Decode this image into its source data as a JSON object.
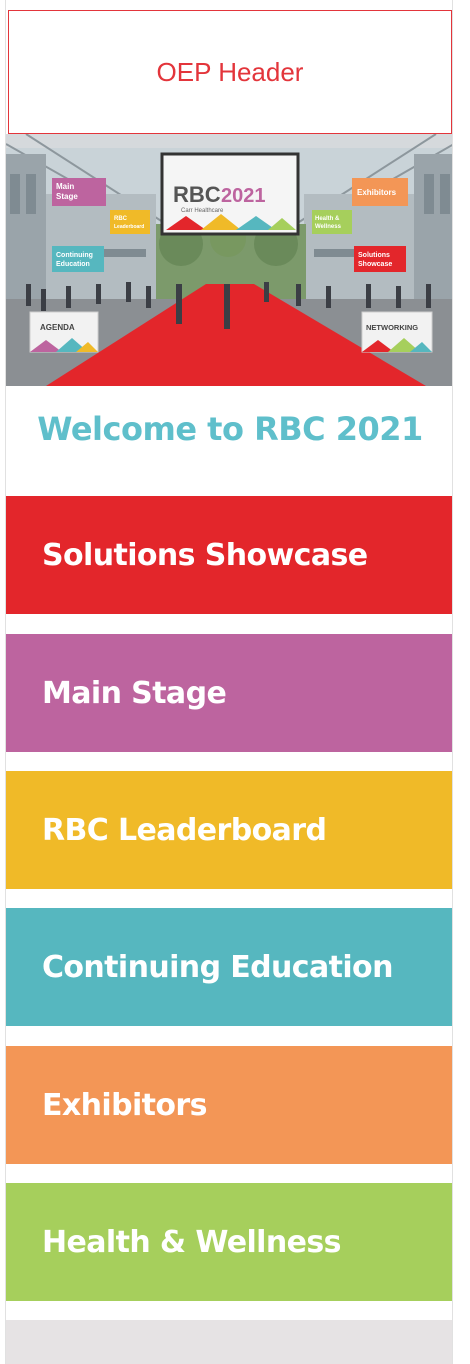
{
  "header": {
    "label": "OEP Header"
  },
  "hero": {
    "screen_logo": "RBC",
    "screen_year": "2021",
    "screen_tagline": "Carr Healthcare",
    "signs": {
      "main_stage": [
        "Main",
        "Stage"
      ],
      "leaderboard": [
        "RBC",
        "Leaderboard"
      ],
      "continuing_education": [
        "Continuing",
        "Education"
      ],
      "exhibitors": "Exhibitors",
      "health": [
        "Health &",
        "Wellness"
      ],
      "solutions": [
        "Solutions",
        "Showcase"
      ],
      "agenda": "AGENDA",
      "networking": "NETWORKING"
    }
  },
  "welcome": {
    "text": "Welcome to RBC 2021"
  },
  "tiles": [
    {
      "label": "Solutions Showcase",
      "color": "#e3262b"
    },
    {
      "label": "Main Stage",
      "color": "#bd649f"
    },
    {
      "label": "RBC Leaderboard",
      "color": "#f0ba28"
    },
    {
      "label": "Continuing Education",
      "color": "#56b7bf"
    },
    {
      "label": "Exhibitors",
      "color": "#f39656"
    },
    {
      "label": "Health & Wellness",
      "color": "#a6cf5c"
    }
  ]
}
